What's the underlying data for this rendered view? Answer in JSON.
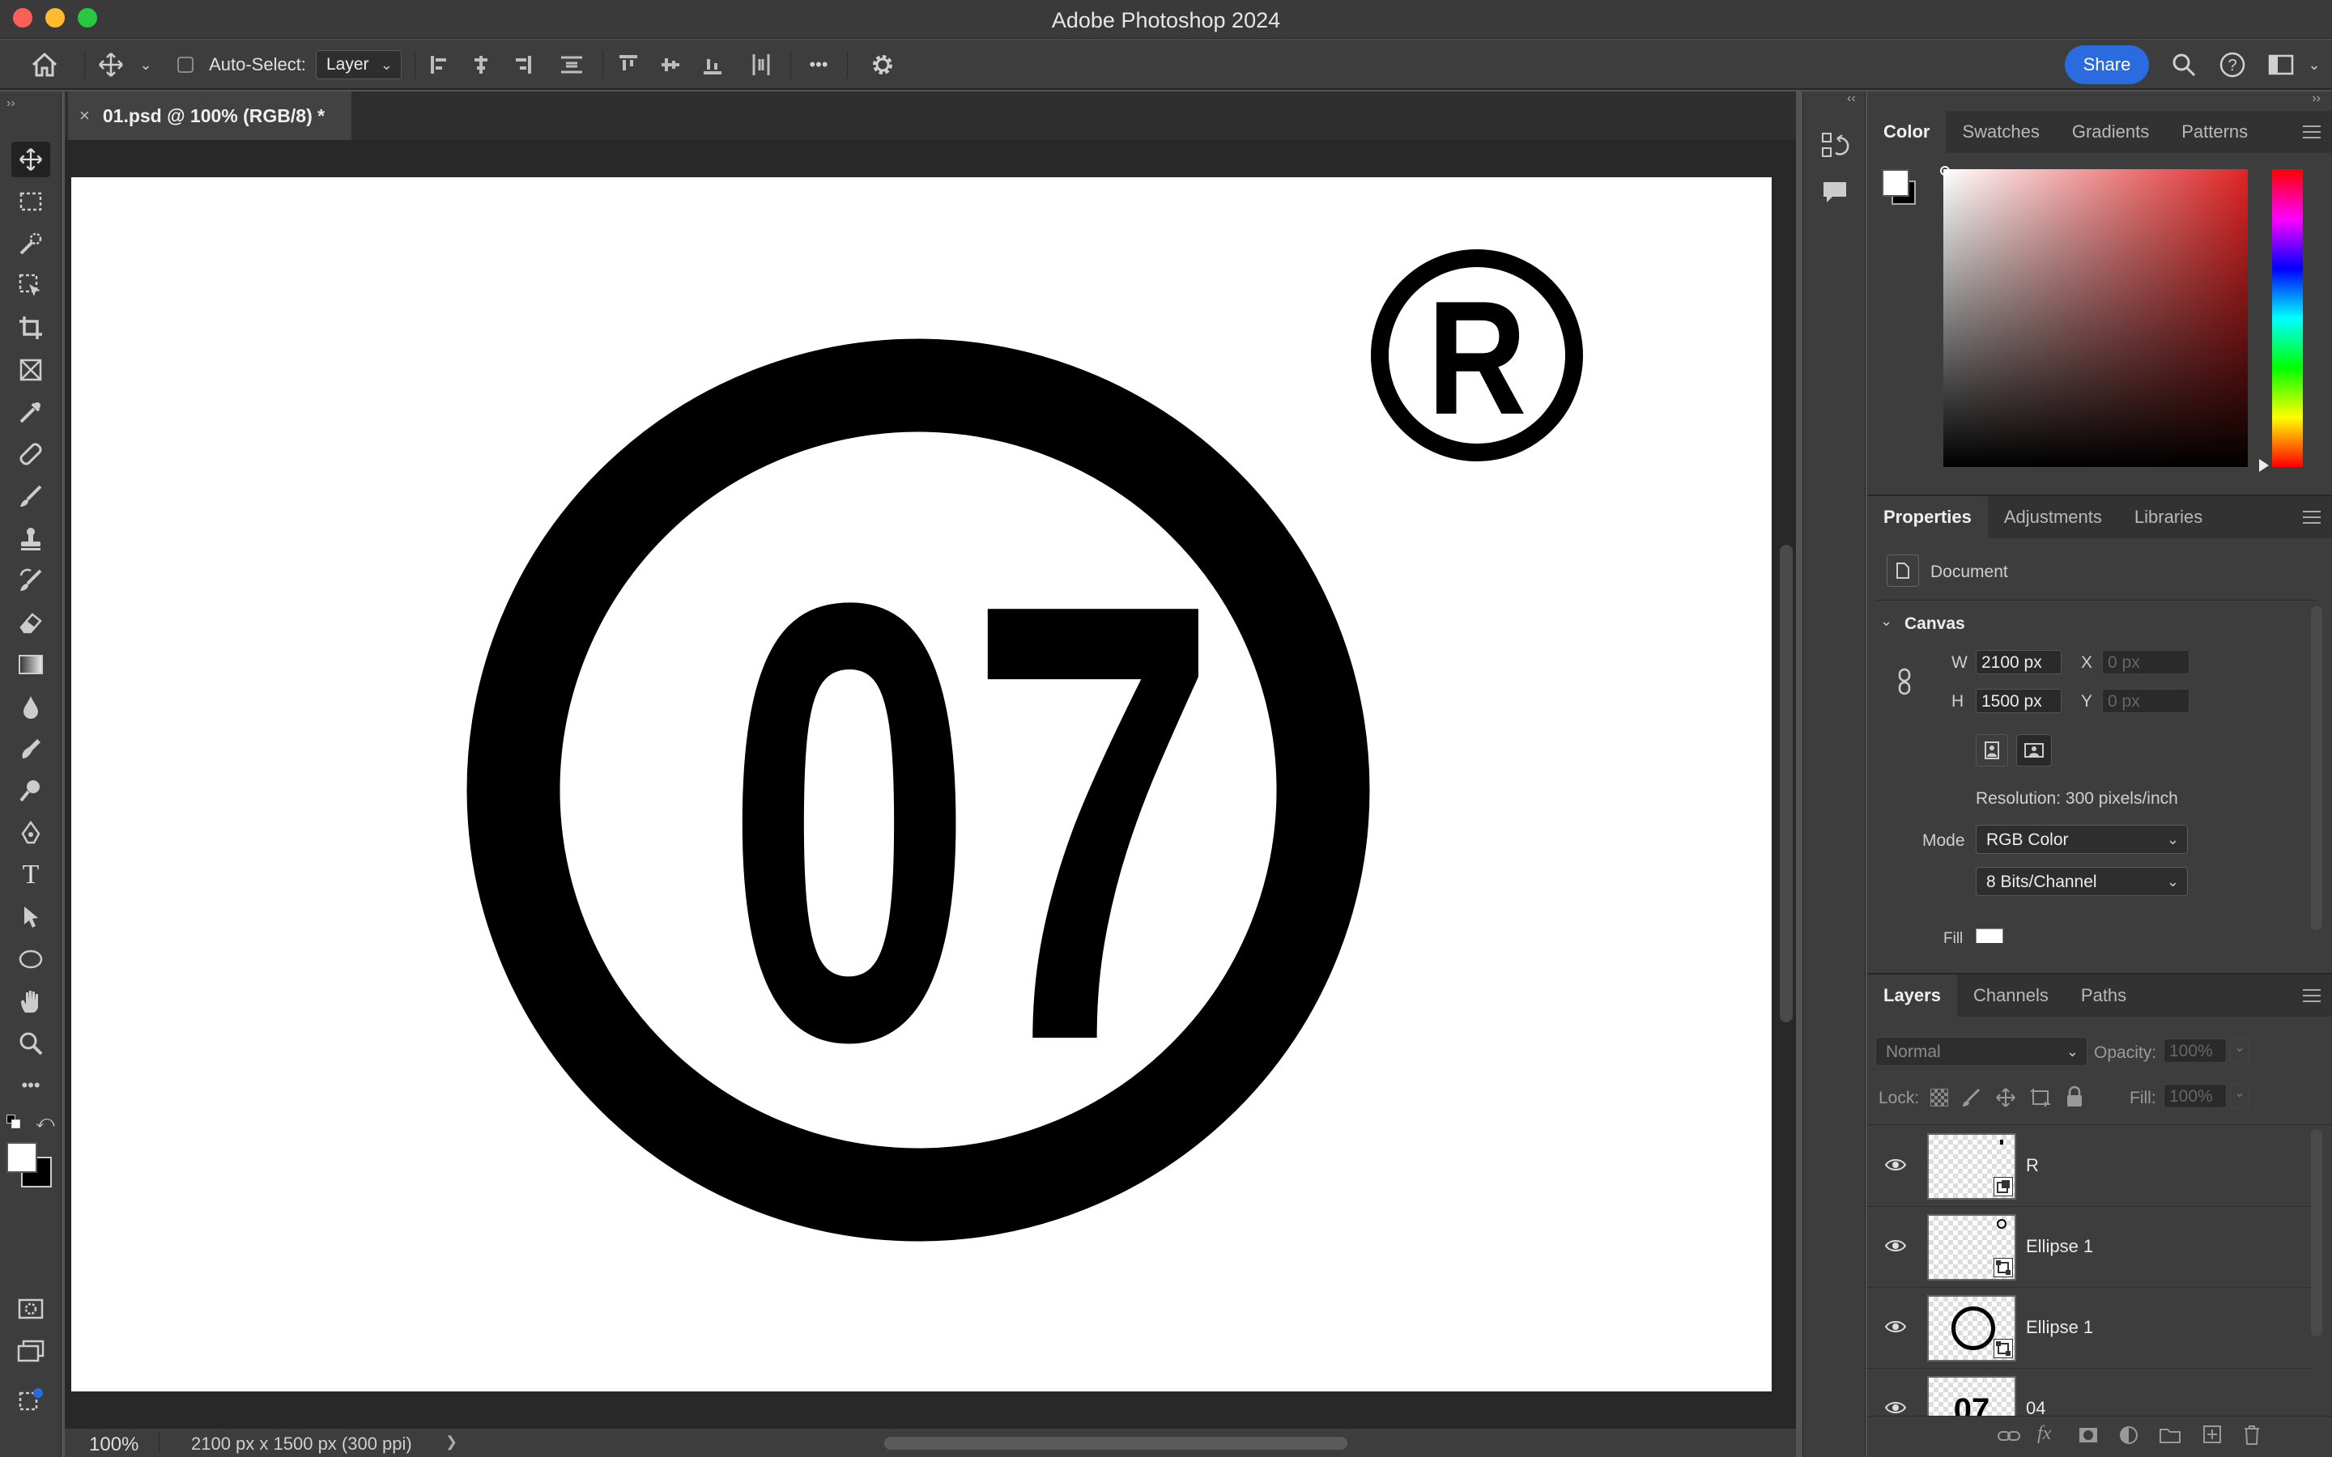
{
  "app": {
    "title": "Adobe Photoshop 2024"
  },
  "options_bar": {
    "auto_select_label": "Auto-Select:",
    "auto_select_target": "Layer",
    "share_label": "Share",
    "more_label": "•••"
  },
  "document": {
    "tab_label": "01.psd @ 100% (RGB/8) *",
    "close_glyph": "×",
    "artwork": {
      "number_text": "07",
      "registered_text": "R"
    }
  },
  "status": {
    "zoom": "100%",
    "doc_info": "2100 px x 1500 px (300 ppi)",
    "arrow": "❯"
  },
  "color_panel": {
    "tabs": [
      "Color",
      "Swatches",
      "Gradients",
      "Patterns"
    ],
    "active_tab": "Color"
  },
  "properties_panel": {
    "tabs": [
      "Properties",
      "Adjustments",
      "Libraries"
    ],
    "active_tab": "Properties",
    "doc_label": "Document",
    "canvas_section": "Canvas",
    "w_label": "W",
    "w_value": "2100 px",
    "h_label": "H",
    "h_value": "1500 px",
    "x_label": "X",
    "x_placeholder": "0 px",
    "y_label": "Y",
    "y_placeholder": "0 px",
    "resolution": "Resolution: 300 pixels/inch",
    "mode_label": "Mode",
    "mode_value": "RGB Color",
    "bits_value": "8 Bits/Channel",
    "fill_label": "Fill"
  },
  "layers_panel": {
    "tabs": [
      "Layers",
      "Channels",
      "Paths"
    ],
    "active_tab": "Layers",
    "blend_mode": "Normal",
    "opacity_label": "Opacity:",
    "opacity_value": "100%",
    "lock_label": "Lock:",
    "fill_label": "Fill:",
    "fill_value": "100%",
    "layers": [
      {
        "name": "R",
        "visible": true
      },
      {
        "name": "Ellipse 1",
        "visible": true
      },
      {
        "name": "Ellipse 1",
        "visible": true
      },
      {
        "name": "04",
        "visible": true
      }
    ],
    "thumb_text": "07"
  },
  "colors": {
    "accent": "#2b6be0",
    "close": "#ff5f57",
    "minimize": "#febc2e",
    "zoom": "#28c840"
  }
}
